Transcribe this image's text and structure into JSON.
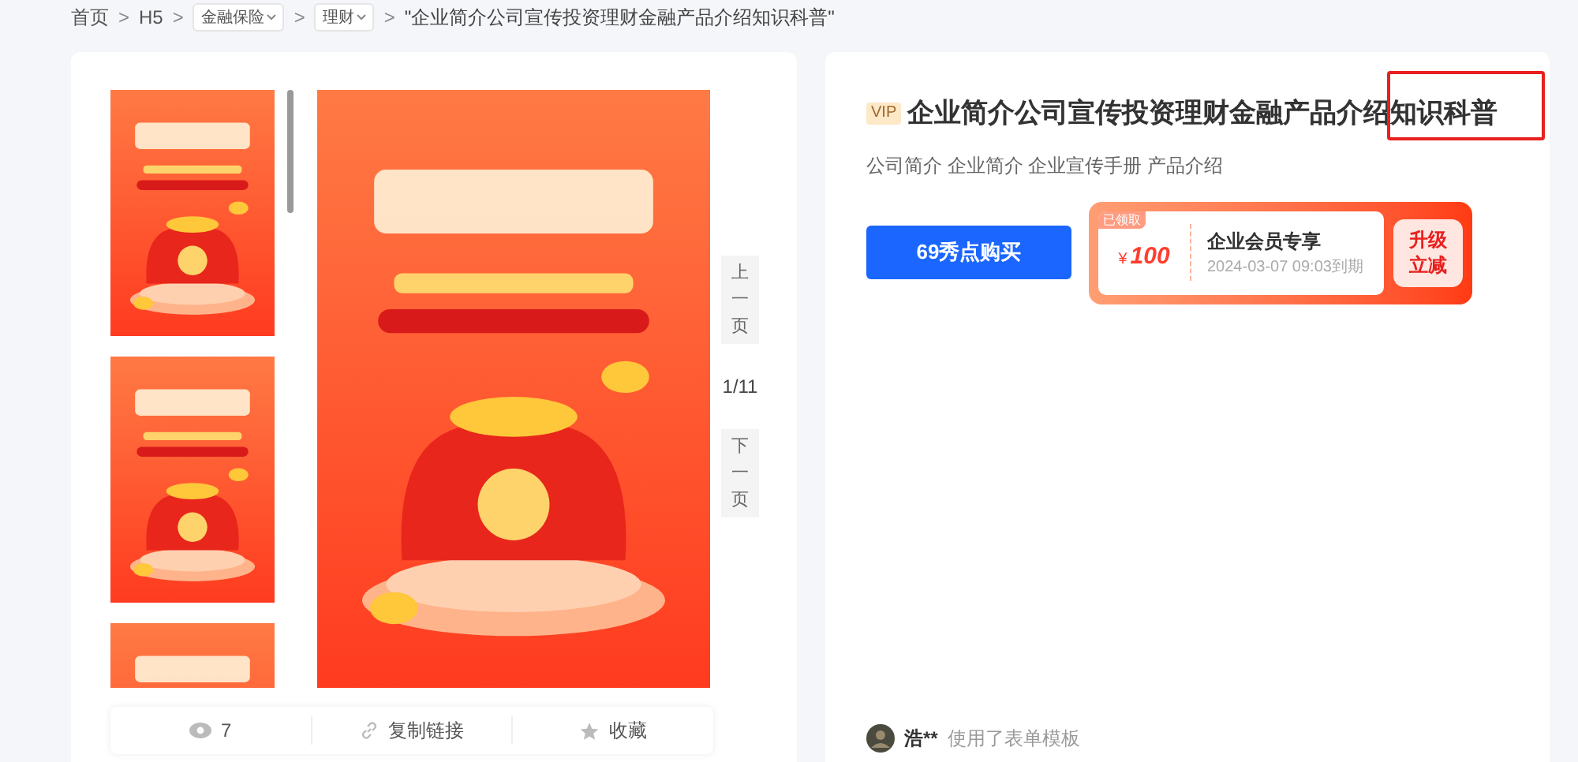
{
  "breadcrumb": [
    {
      "kind": "link",
      "label": "首页"
    },
    {
      "kind": "link",
      "label": "H5"
    },
    {
      "kind": "dropdown",
      "label": "金融保险"
    },
    {
      "kind": "dropdown",
      "label": "理财"
    },
    {
      "kind": "current",
      "label": "\"企业简介公司宣传投资理财金融产品介绍知识科普\""
    }
  ],
  "breadcrumb_separator": ">",
  "preview": {
    "prev_page": "上一页",
    "page_counter": "1/11",
    "next_page": "下一页",
    "actions": [
      {
        "kind": "views",
        "label": "7"
      },
      {
        "kind": "link",
        "label": "复制链接"
      },
      {
        "kind": "favorite",
        "label": "收藏"
      }
    ]
  },
  "detail": {
    "badge": "VIP",
    "title_main": "企业简介公司宣传投资理财金融产品介绍",
    "title_highlighted": "知识科普",
    "tags": "公司简介 企业简介 企业宣传手册 产品介绍",
    "buy_button": "69秀点购买",
    "coupon": {
      "status": "已领取",
      "currency": "¥",
      "amount": "100",
      "title": "企业会员专享",
      "expiry": "2024-03-07 09:03到期",
      "action": "升级立减"
    },
    "activity": {
      "user": "浩**",
      "text": "使用了表单模板"
    }
  }
}
